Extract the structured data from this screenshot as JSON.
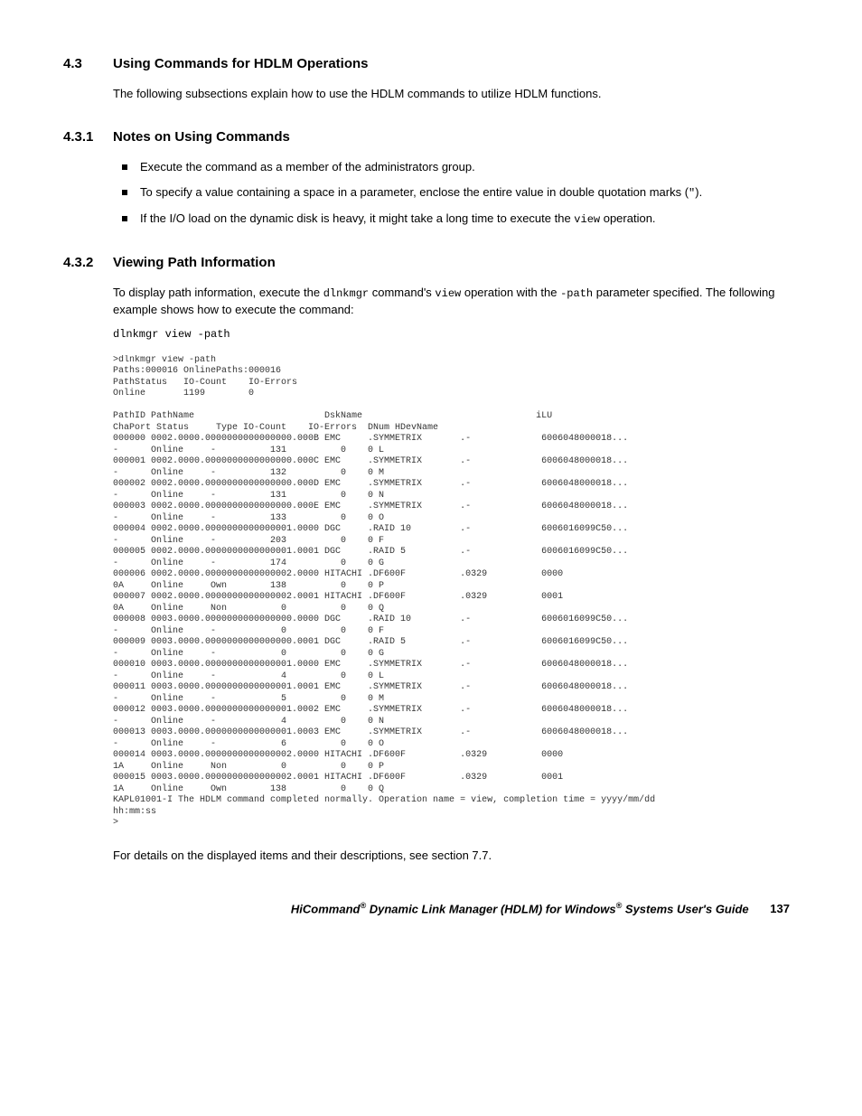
{
  "s43": {
    "num": "4.3",
    "title": "Using Commands for HDLM Operations",
    "intro": "The following subsections explain how to use the HDLM commands to utilize HDLM functions."
  },
  "s431": {
    "num": "4.3.1",
    "title": "Notes on Using Commands",
    "b1": "Execute the command as a member of the administrators group.",
    "b2a": "To specify a value containing a space in a parameter, enclose the entire value in double quotation marks (",
    "b2quote": "\"",
    "b2b": ").",
    "b3a": "If the I/O load on the dynamic disk is heavy, it might take a long time to execute the ",
    "b3code": "view",
    "b3b": " operation."
  },
  "s432": {
    "num": "4.3.2",
    "title": "Viewing Path Information",
    "p1a": "To display path information, execute the ",
    "p1code1": "dlnkmgr",
    "p1b": " command's ",
    "p1code2": "view",
    "p1c": " operation with the ",
    "p1code3": "-path",
    "p1d": " parameter specified. The following example shows how to execute the command:",
    "cmd": "dlnkmgr view -path",
    "after": "For details on the displayed items and their descriptions, see section 7.7."
  },
  "terminal": ">dlnkmgr view -path\nPaths:000016 OnlinePaths:000016\nPathStatus   IO-Count    IO-Errors\nOnline       1199        0\n\nPathID PathName                        DskName                                iLU\nChaPort Status     Type IO-Count    IO-Errors  DNum HDevName\n000000 0002.0000.0000000000000000.000B EMC     .SYMMETRIX       .-             6006048000018...\n-      Online     -          131          0    0 L\n000001 0002.0000.0000000000000000.000C EMC     .SYMMETRIX       .-             6006048000018...\n-      Online     -          132          0    0 M\n000002 0002.0000.0000000000000000.000D EMC     .SYMMETRIX       .-             6006048000018...\n-      Online     -          131          0    0 N\n000003 0002.0000.0000000000000000.000E EMC     .SYMMETRIX       .-             6006048000018...\n-      Online     -          133          0    0 O\n000004 0002.0000.0000000000000001.0000 DGC     .RAID 10         .-             6006016099C50...\n-      Online     -          203          0    0 F\n000005 0002.0000.0000000000000001.0001 DGC     .RAID 5          .-             6006016099C50...\n-      Online     -          174          0    0 G\n000006 0002.0000.0000000000000002.0000 HITACHI .DF600F          .0329          0000\n0A     Online     Own        138          0    0 P\n000007 0002.0000.0000000000000002.0001 HITACHI .DF600F          .0329          0001\n0A     Online     Non          0          0    0 Q\n000008 0003.0000.0000000000000000.0000 DGC     .RAID 10         .-             6006016099C50...\n-      Online     -            0          0    0 F\n000009 0003.0000.0000000000000000.0001 DGC     .RAID 5          .-             6006016099C50...\n-      Online     -            0          0    0 G\n000010 0003.0000.0000000000000001.0000 EMC     .SYMMETRIX       .-             6006048000018...\n-      Online     -            4          0    0 L\n000011 0003.0000.0000000000000001.0001 EMC     .SYMMETRIX       .-             6006048000018...\n-      Online     -            5          0    0 M\n000012 0003.0000.0000000000000001.0002 EMC     .SYMMETRIX       .-             6006048000018...\n-      Online     -            4          0    0 N\n000013 0003.0000.0000000000000001.0003 EMC     .SYMMETRIX       .-             6006048000018...\n-      Online     -            6          0    0 O\n000014 0003.0000.0000000000000002.0000 HITACHI .DF600F          .0329          0000\n1A     Online     Non          0          0    0 P\n000015 0003.0000.0000000000000002.0001 HITACHI .DF600F          .0329          0001\n1A     Online     Own        138          0    0 Q\nKAPL01001-I The HDLM command completed normally. Operation name = view, completion time = yyyy/mm/dd\nhh:mm:ss\n>",
  "footer": {
    "title_a": "HiCommand",
    "title_sup1": "®",
    "title_b": " Dynamic Link Manager (HDLM) for Windows",
    "title_sup2": "®",
    "title_c": " Systems User's Guide",
    "page": "137"
  }
}
